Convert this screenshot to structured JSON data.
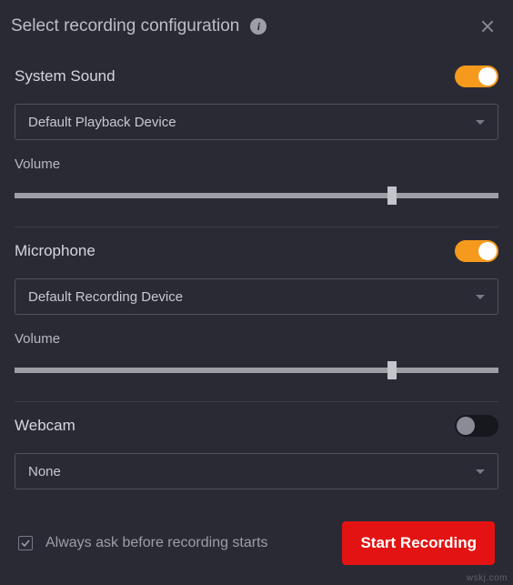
{
  "header": {
    "title": "Select recording configuration"
  },
  "system_sound": {
    "label": "System Sound",
    "toggle": true,
    "device": "Default Playback Device",
    "volume_label": "Volume",
    "volume_percent": 78
  },
  "microphone": {
    "label": "Microphone",
    "toggle": true,
    "device": "Default Recording Device",
    "volume_label": "Volume",
    "volume_percent": 78
  },
  "webcam": {
    "label": "Webcam",
    "toggle": false,
    "device": "None"
  },
  "footer": {
    "always_ask_label": "Always ask before recording starts",
    "always_ask_checked": true,
    "start_button": "Start Recording"
  },
  "colors": {
    "accent": "#f59a1c",
    "danger": "#e31313",
    "bg": "#2a2a34"
  },
  "watermark": "wskj.com"
}
